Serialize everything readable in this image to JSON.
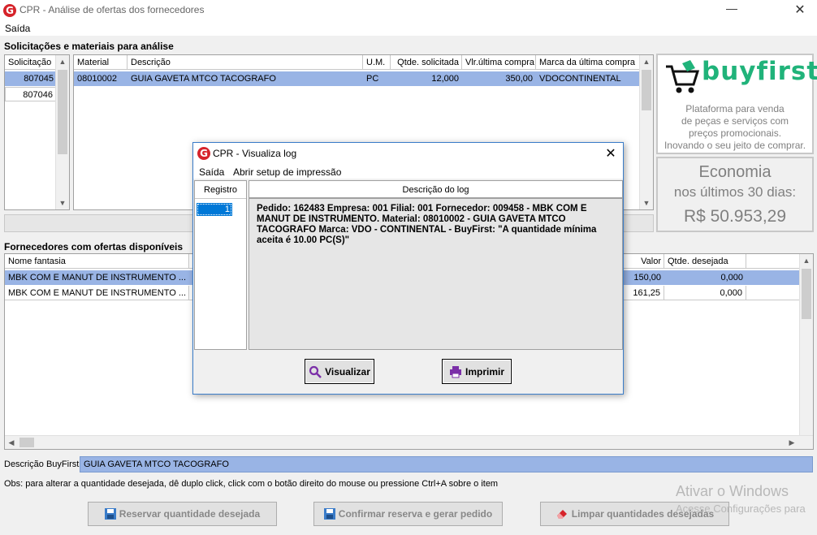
{
  "window": {
    "title": "CPR - Análise de ofertas dos fornecedores",
    "minimize": "—",
    "close": "✕"
  },
  "menu": {
    "exit": "Saída"
  },
  "requests_section": {
    "label": "Solicitações e materiais para análise"
  },
  "requests_grid": {
    "header": "Solicitação",
    "rows": [
      "807045",
      "807046"
    ]
  },
  "materials_grid": {
    "headers": [
      "Material",
      "Descrição",
      "U.M.",
      "Qtde. solicitada",
      "Vlr.última compra",
      "Marca da última compra"
    ],
    "rows": [
      [
        "08010002",
        "GUIA GAVETA MTCO TACOGRAFO",
        "PC",
        "12,000",
        "350,00",
        "VDOCONTINENTAL"
      ]
    ]
  },
  "buyfirst": {
    "brand": "buyfirst",
    "tagline": [
      "Plataforma para venda",
      "de peças e serviços com",
      "preços promocionais.",
      "Inovando o seu jeito de comprar."
    ],
    "savings_title": "Economia",
    "savings_period": "nos últimos 30 dias:",
    "savings_value": "R$  50.953,29"
  },
  "suppliers_section": {
    "label": "Fornecedores com ofertas disponíveis"
  },
  "suppliers_grid": {
    "headers": {
      "name": "Nome fantasia",
      "value": "Valor",
      "desired": "Qtde. desejada"
    },
    "rows": [
      {
        "name": "MBK COM E MANUT DE INSTRUMENTO ...",
        "value": "150,00",
        "desired": "0,000"
      },
      {
        "name": "MBK COM E MANUT DE INSTRUMENTO ...",
        "value": "161,25",
        "desired": "0,000"
      }
    ]
  },
  "buyfirst_description": {
    "label": "Descrição BuyFirst",
    "value": "GUIA GAVETA MTCO TACOGRAFO"
  },
  "note": "Obs: para alterar a quantidade desejada, dê duplo click, click com o botão direito do mouse ou pressione Ctrl+A sobre o item",
  "buttons": {
    "reserve": "Reservar quantidade desejada",
    "confirm": "Confirmar reserva e gerar pedido",
    "clear": "Limpar quantidades desejadas"
  },
  "watermark": {
    "line1": "Ativar o Windows",
    "line2": "Acesse Configurações para"
  },
  "dialog": {
    "title": "CPR - Visualiza log",
    "close": "✕",
    "menu": [
      "Saída",
      "Abrir setup de impressão"
    ],
    "headers": {
      "record": "Registro",
      "description": "Descrição do log"
    },
    "record": "1",
    "log_text": "Pedido: 162483 Empresa: 001 Filial: 001 Fornecedor: 009458 - MBK COM E MANUT DE INSTRUMENTO. Material: 08010002 - GUIA GAVETA MTCO TACOGRAFO Marca: VDO - CONTINENTAL - BuyFirst: \"A quantidade mínima aceita é 10.00 PC(S)\"",
    "view_button": "Visualizar",
    "print_button": "Imprimir"
  },
  "colors": {
    "selection": "#99b4e5",
    "brand": "#20b37a",
    "accent": "#3a7cc9"
  }
}
